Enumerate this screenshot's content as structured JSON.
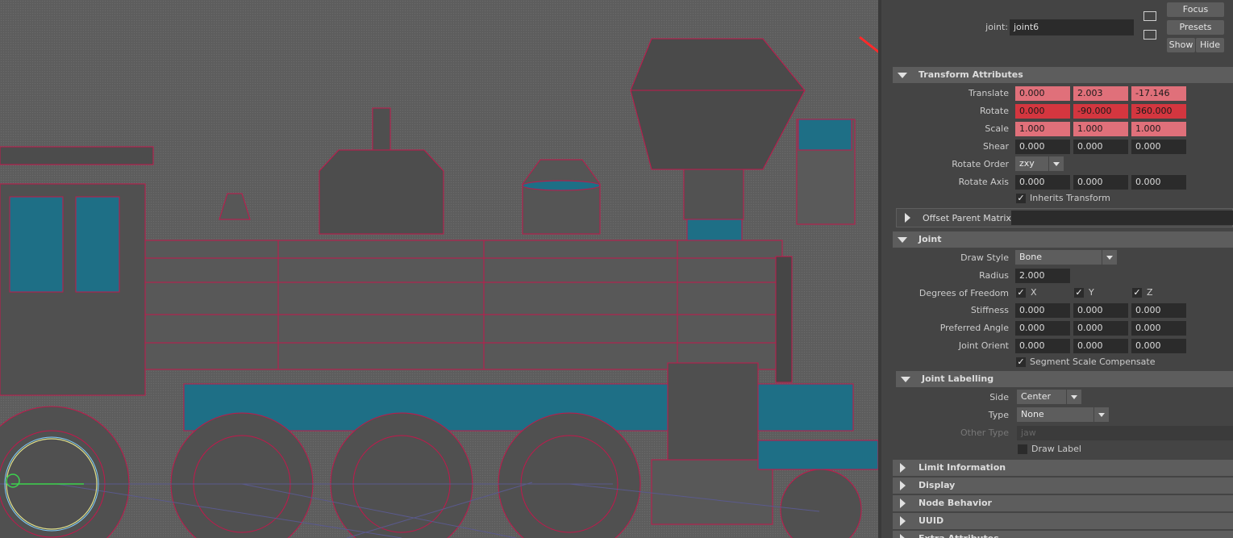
{
  "header": {
    "node_label": "joint:",
    "node_value": "joint6",
    "focus_label": "Focus",
    "presets_label": "Presets",
    "show_label": "Show",
    "hide_label": "Hide"
  },
  "transform": {
    "title": "Transform Attributes",
    "translate": {
      "label": "Translate",
      "x": "0.000",
      "y": "2.003",
      "z": "-17.146"
    },
    "rotate": {
      "label": "Rotate",
      "x": "0.000",
      "y": "-90.000",
      "z": "360.000"
    },
    "scale": {
      "label": "Scale",
      "x": "1.000",
      "y": "1.000",
      "z": "1.000"
    },
    "shear": {
      "label": "Shear",
      "x": "0.000",
      "y": "0.000",
      "z": "0.000"
    },
    "rotate_order": {
      "label": "Rotate Order",
      "value": "zxy"
    },
    "rotate_axis": {
      "label": "Rotate Axis",
      "x": "0.000",
      "y": "0.000",
      "z": "0.000"
    },
    "inherits_transform": "Inherits Transform"
  },
  "offset_parent": {
    "title": "Offset Parent Matrix"
  },
  "joint": {
    "title": "Joint",
    "draw_style": {
      "label": "Draw Style",
      "value": "Bone"
    },
    "radius": {
      "label": "Radius",
      "value": "2.000"
    },
    "dof": {
      "label": "Degrees of Freedom",
      "x": "X",
      "y": "Y",
      "z": "Z"
    },
    "stiffness": {
      "label": "Stiffness",
      "x": "0.000",
      "y": "0.000",
      "z": "0.000"
    },
    "preferred_angle": {
      "label": "Preferred Angle",
      "x": "0.000",
      "y": "0.000",
      "z": "0.000"
    },
    "joint_orient": {
      "label": "Joint Orient",
      "x": "0.000",
      "y": "0.000",
      "z": "0.000"
    },
    "segment_scale": "Segment Scale Compensate"
  },
  "labelling": {
    "title": "Joint Labelling",
    "side": {
      "label": "Side",
      "value": "Center"
    },
    "type": {
      "label": "Type",
      "value": "None"
    },
    "other_type": {
      "label": "Other Type",
      "placeholder": "jaw"
    },
    "draw_label": "Draw Label"
  },
  "collapsed_sections": [
    "Limit Information",
    "Display",
    "Node Behavior",
    "UUID",
    "Extra Attributes"
  ],
  "colors": {
    "keyed": "#e0707a",
    "locked": "#d4363f",
    "wire": "#c2184c",
    "teal": "#1e6f86"
  }
}
